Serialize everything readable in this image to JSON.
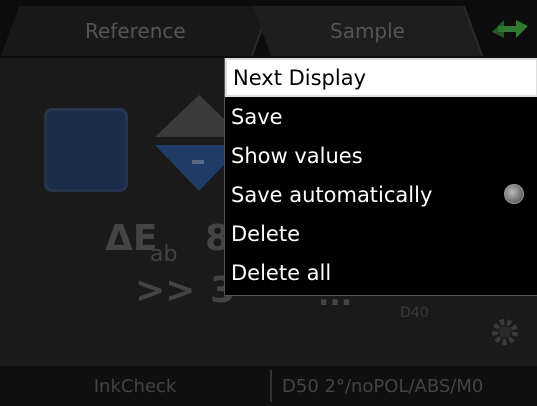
{
  "tabs": {
    "reference": "Reference",
    "sample": "Sample"
  },
  "measurement": {
    "delta_symbol": "ΔE",
    "delta_sub": "ab",
    "delta_value": "8",
    "chevrons": ">>",
    "second_value": "3",
    "extra_value": "...",
    "extra_sub": "D40"
  },
  "status": {
    "mode": "InkCheck",
    "settings": "D50 2°/noPOL/ABS/M0"
  },
  "menu": {
    "items": [
      {
        "label": "Next Display",
        "selected": true
      },
      {
        "label": "Save"
      },
      {
        "label": "Show values"
      },
      {
        "label": "Save automatically",
        "toggle": "radio"
      },
      {
        "label": "Delete"
      },
      {
        "label": "Delete all"
      }
    ]
  },
  "colors": {
    "swatch": "#1a2c4a",
    "menu_bg": "#000000",
    "menu_selected_bg": "#ffffff"
  },
  "icons": {
    "tab_icon": "sync-arrows-icon",
    "settings": "gear-icon",
    "radio": "radio-button-icon"
  }
}
